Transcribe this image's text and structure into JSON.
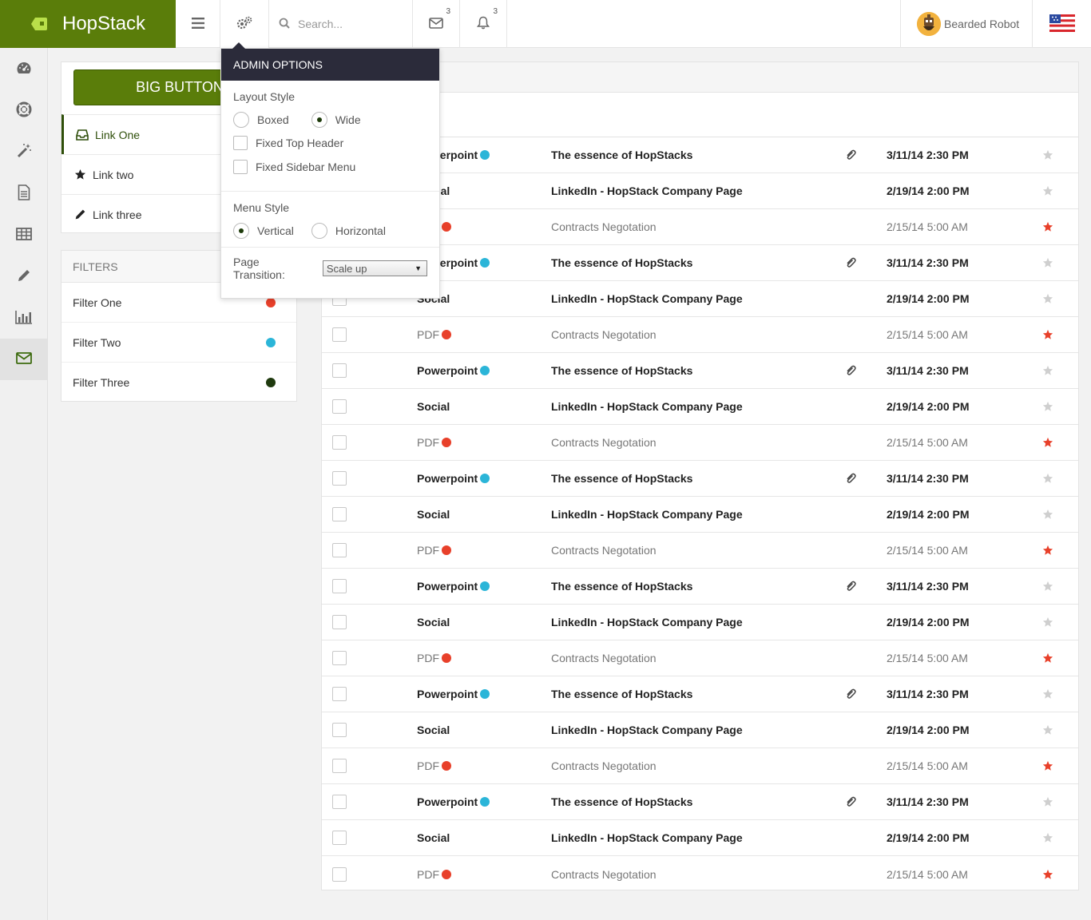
{
  "app": {
    "name": "HopStack"
  },
  "header": {
    "search_placeholder": "Search...",
    "messages_count": "3",
    "notifications_count": "3",
    "user_name": "Bearded Robot"
  },
  "sidebar_icons": [
    "dashboard-icon",
    "life-ring-icon",
    "magic-wand-icon",
    "document-icon",
    "table-icon",
    "pencil-icon",
    "bar-chart-icon",
    "envelope-icon"
  ],
  "nav": {
    "big_button_label": "BIG BUTTON",
    "links": [
      {
        "label": "Link One",
        "icon": "inbox-icon"
      },
      {
        "label": "Link two",
        "icon": "star-icon"
      },
      {
        "label": "Link three",
        "icon": "pencil-icon"
      }
    ]
  },
  "filters": {
    "title": "FILTERS",
    "items": [
      {
        "label": "Filter One",
        "color": "#e8402a"
      },
      {
        "label": "Filter Two",
        "color": "#2bb5d8"
      },
      {
        "label": "Filter Three",
        "color": "#1f3a0e"
      }
    ]
  },
  "admin": {
    "title": "ADMIN OPTIONS",
    "layout_style_label": "Layout Style",
    "layout_boxed": "Boxed",
    "layout_wide": "Wide",
    "fixed_top_header": "Fixed Top Header",
    "fixed_sidebar_menu": "Fixed Sidebar Menu",
    "menu_style_label": "Menu Style",
    "menu_vertical": "Vertical",
    "menu_horizontal": "Horizontal",
    "page_transition_label": "Page Transition:",
    "page_transition_value": "Scale up"
  },
  "colors": {
    "brand": "#5a7d0a",
    "dark_header": "#2b2b3a",
    "red": "#e8402a",
    "blue": "#2bb5d8",
    "star_off": "#cfcfcf"
  },
  "mail": {
    "rows": [
      {
        "type": "Powerpoint",
        "dot": "#2bb5d8",
        "subject": "The essence of HopStacks",
        "attach": true,
        "date": "3/11/14 2:30 PM",
        "starred": false,
        "bold": true
      },
      {
        "type": "Social",
        "dot": "",
        "subject": "LinkedIn - HopStack Company Page",
        "attach": false,
        "date": "2/19/14 2:00 PM",
        "starred": false,
        "bold": true
      },
      {
        "type": "PDF",
        "dot": "#e8402a",
        "subject": "Contracts Negotation",
        "attach": false,
        "date": "2/15/14 5:00 AM",
        "starred": true,
        "bold": false
      },
      {
        "type": "Powerpoint",
        "dot": "#2bb5d8",
        "subject": "The essence of HopStacks",
        "attach": true,
        "date": "3/11/14 2:30 PM",
        "starred": false,
        "bold": true
      },
      {
        "type": "Social",
        "dot": "",
        "subject": "LinkedIn - HopStack Company Page",
        "attach": false,
        "date": "2/19/14 2:00 PM",
        "starred": false,
        "bold": true
      },
      {
        "type": "PDF",
        "dot": "#e8402a",
        "subject": "Contracts Negotation",
        "attach": false,
        "date": "2/15/14 5:00 AM",
        "starred": true,
        "bold": false
      },
      {
        "type": "Powerpoint",
        "dot": "#2bb5d8",
        "subject": "The essence of HopStacks",
        "attach": true,
        "date": "3/11/14 2:30 PM",
        "starred": false,
        "bold": true
      },
      {
        "type": "Social",
        "dot": "",
        "subject": "LinkedIn - HopStack Company Page",
        "attach": false,
        "date": "2/19/14 2:00 PM",
        "starred": false,
        "bold": true
      },
      {
        "type": "PDF",
        "dot": "#e8402a",
        "subject": "Contracts Negotation",
        "attach": false,
        "date": "2/15/14 5:00 AM",
        "starred": true,
        "bold": false
      },
      {
        "type": "Powerpoint",
        "dot": "#2bb5d8",
        "subject": "The essence of HopStacks",
        "attach": true,
        "date": "3/11/14 2:30 PM",
        "starred": false,
        "bold": true
      },
      {
        "type": "Social",
        "dot": "",
        "subject": "LinkedIn - HopStack Company Page",
        "attach": false,
        "date": "2/19/14 2:00 PM",
        "starred": false,
        "bold": true
      },
      {
        "type": "PDF",
        "dot": "#e8402a",
        "subject": "Contracts Negotation",
        "attach": false,
        "date": "2/15/14 5:00 AM",
        "starred": true,
        "bold": false
      },
      {
        "type": "Powerpoint",
        "dot": "#2bb5d8",
        "subject": "The essence of HopStacks",
        "attach": true,
        "date": "3/11/14 2:30 PM",
        "starred": false,
        "bold": true
      },
      {
        "type": "Social",
        "dot": "",
        "subject": "LinkedIn - HopStack Company Page",
        "attach": false,
        "date": "2/19/14 2:00 PM",
        "starred": false,
        "bold": true
      },
      {
        "type": "PDF",
        "dot": "#e8402a",
        "subject": "Contracts Negotation",
        "attach": false,
        "date": "2/15/14 5:00 AM",
        "starred": true,
        "bold": false
      },
      {
        "type": "Powerpoint",
        "dot": "#2bb5d8",
        "subject": "The essence of HopStacks",
        "attach": true,
        "date": "3/11/14 2:30 PM",
        "starred": false,
        "bold": true
      },
      {
        "type": "Social",
        "dot": "",
        "subject": "LinkedIn - HopStack Company Page",
        "attach": false,
        "date": "2/19/14 2:00 PM",
        "starred": false,
        "bold": true
      },
      {
        "type": "PDF",
        "dot": "#e8402a",
        "subject": "Contracts Negotation",
        "attach": false,
        "date": "2/15/14 5:00 AM",
        "starred": true,
        "bold": false
      },
      {
        "type": "Powerpoint",
        "dot": "#2bb5d8",
        "subject": "The essence of HopStacks",
        "attach": true,
        "date": "3/11/14 2:30 PM",
        "starred": false,
        "bold": true
      },
      {
        "type": "Social",
        "dot": "",
        "subject": "LinkedIn - HopStack Company Page",
        "attach": false,
        "date": "2/19/14 2:00 PM",
        "starred": false,
        "bold": true
      },
      {
        "type": "PDF",
        "dot": "#e8402a",
        "subject": "Contracts Negotation",
        "attach": false,
        "date": "2/15/14 5:00 AM",
        "starred": true,
        "bold": false
      }
    ]
  }
}
